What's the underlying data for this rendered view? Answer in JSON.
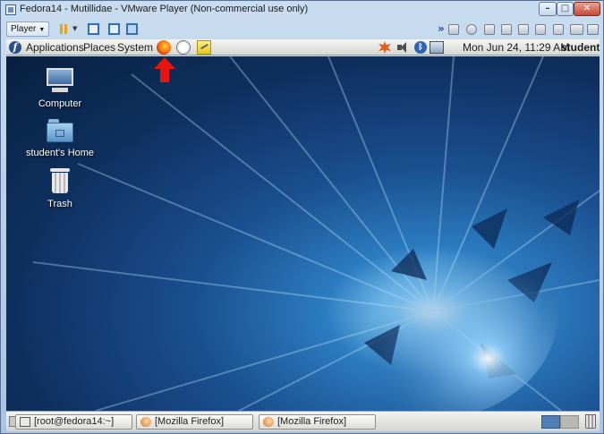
{
  "window": {
    "title": "Fedora14 - Mutillidae - VMware Player (Non-commercial use only)",
    "buttons": [
      "minimize",
      "maximize",
      "close"
    ]
  },
  "vmware_toolbar": {
    "player_menu_label": "Player",
    "left_buttons": [
      "pause",
      "send-ctrl-alt-del",
      "full-screen",
      "unity"
    ],
    "device_icons": [
      "hard-disk",
      "cd-dvd",
      "floppy",
      "network-adapter",
      "usb",
      "sound-card",
      "printer",
      "display"
    ]
  },
  "gnome_top_panel": {
    "menus": [
      "Applications",
      "Places",
      "System"
    ],
    "launchers": [
      "firefox",
      "evolution-mail",
      "notes"
    ],
    "tray_icons": [
      "update",
      "volume",
      "bluetooth",
      "network"
    ],
    "clock": "Mon Jun 24, 11:29 AM",
    "user": "student"
  },
  "annotation": {
    "arrow_color": "#e8140d",
    "points_to": "firefox-launcher"
  },
  "desktop": {
    "icons": [
      {
        "label": "Computer"
      },
      {
        "label": "student's Home"
      },
      {
        "label": "Trash"
      }
    ]
  },
  "gnome_bottom_panel": {
    "tasks": [
      {
        "label": "[root@fedora14:~]"
      },
      {
        "label": "[Mozilla Firefox]"
      },
      {
        "label": "[Mozilla Firefox]"
      }
    ],
    "workspaces": 2,
    "active_workspace": 1
  },
  "colors": {
    "desktop_blue": "#1a4f8f",
    "panel_gray": "#d7d7d3",
    "titlebar_blue": "#c9dcef"
  }
}
